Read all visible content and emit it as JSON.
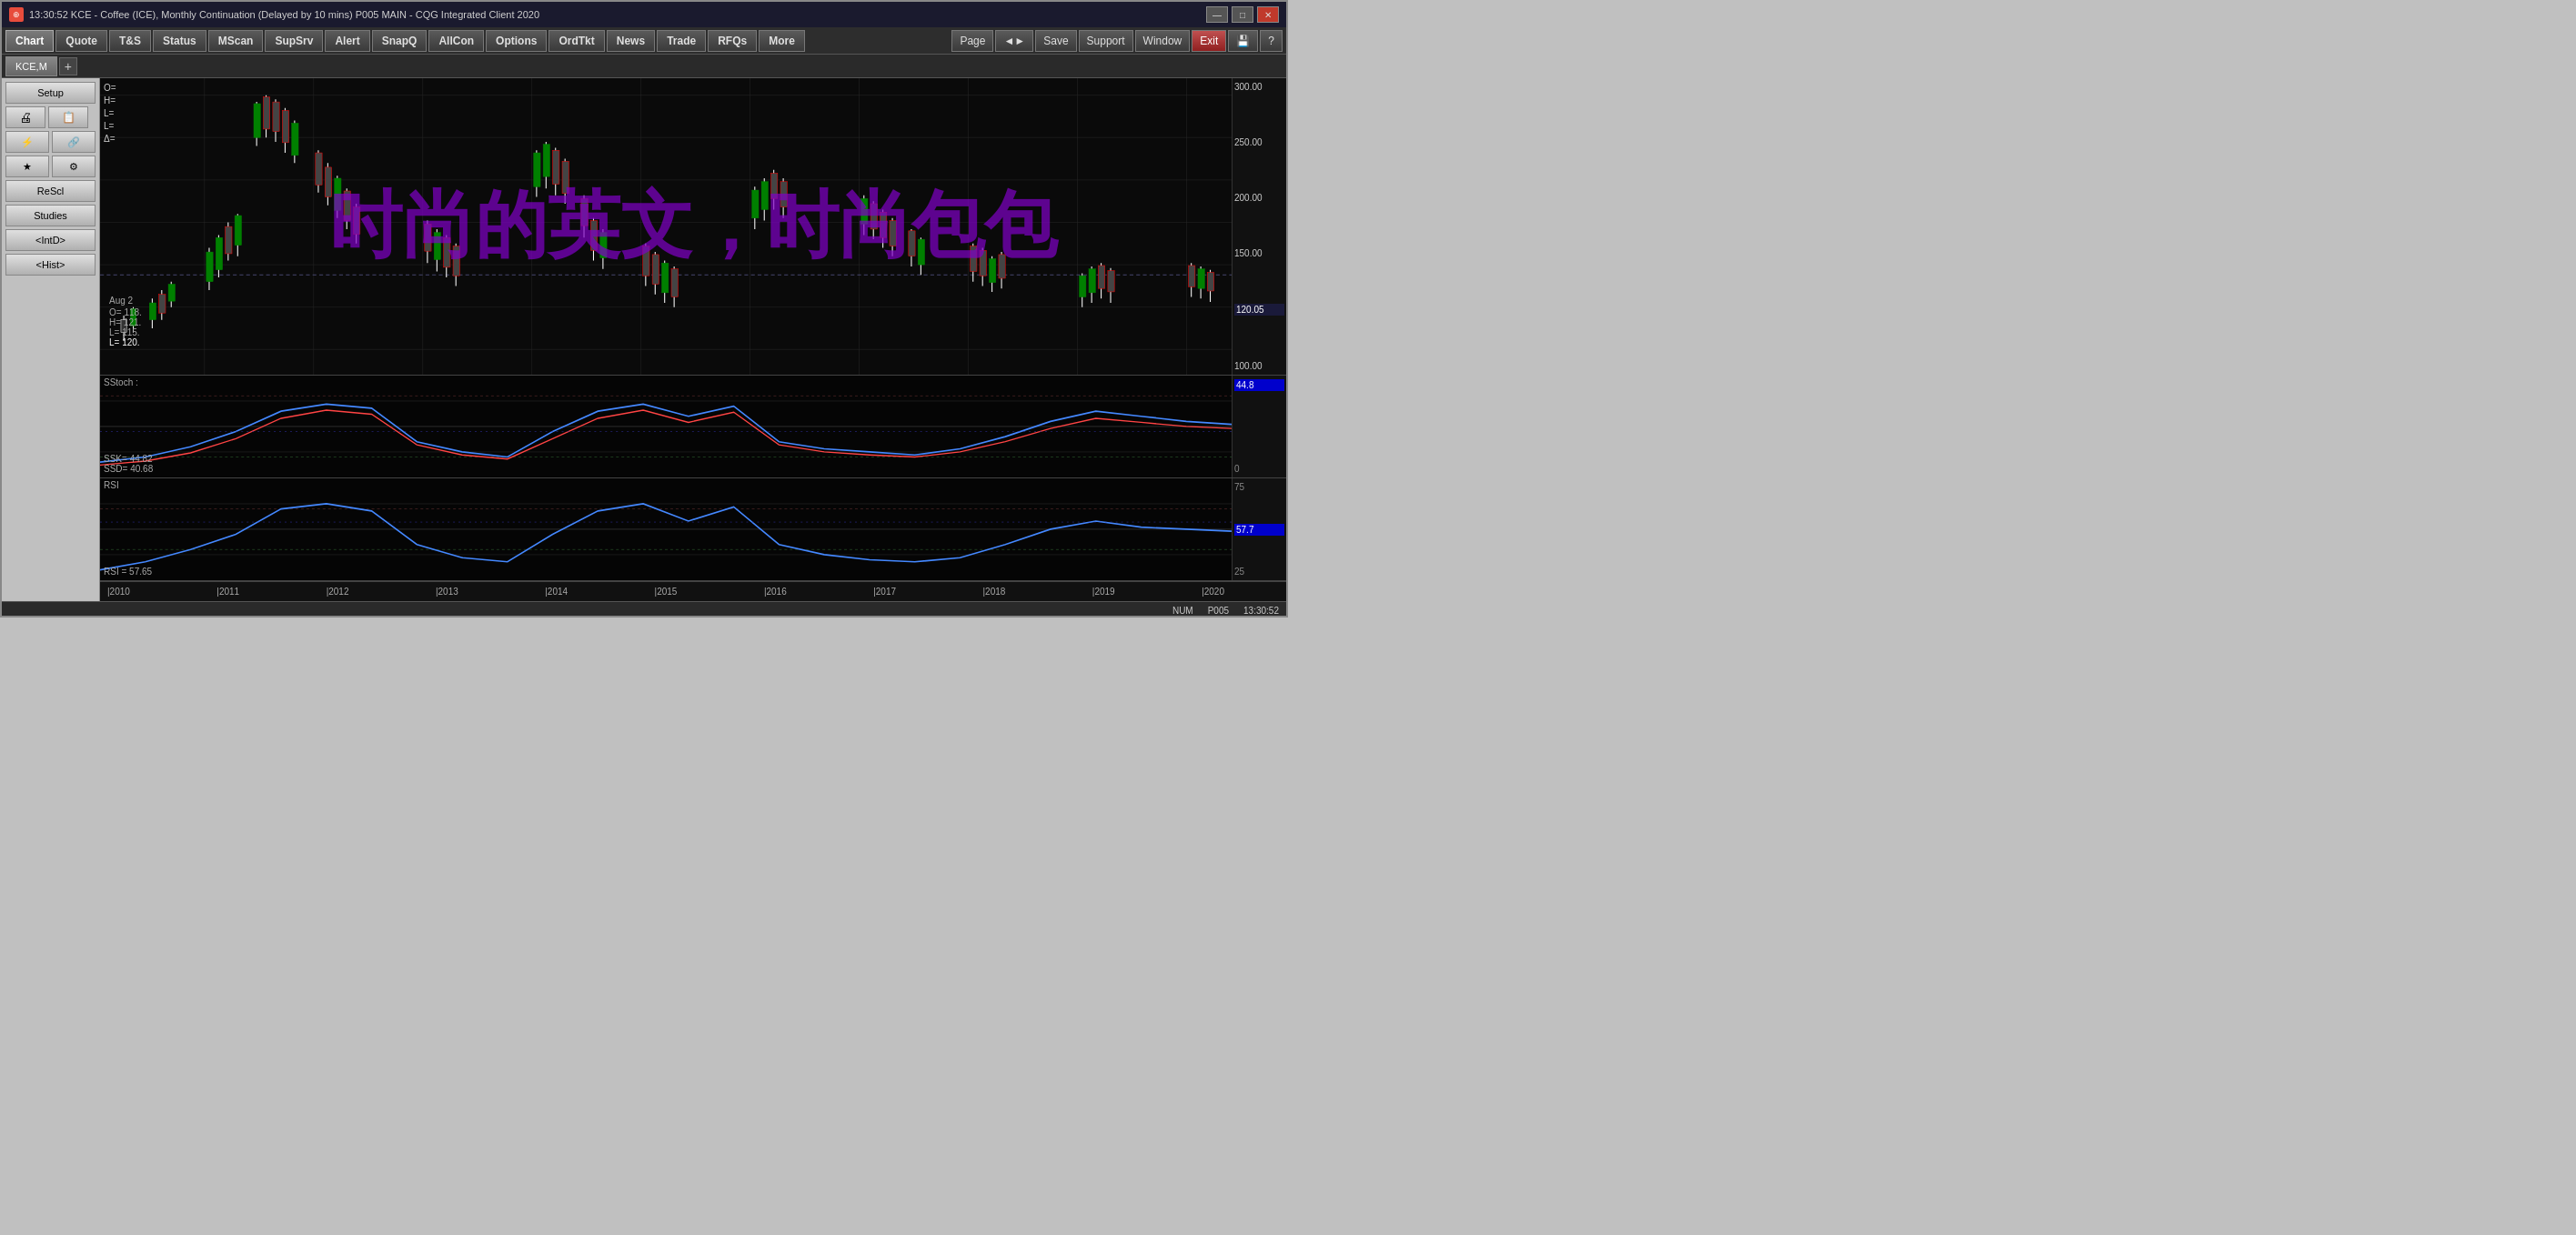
{
  "titleBar": {
    "icon": "★",
    "text": "13:30:52   KCE - Coffee (ICE), Monthly Continuation (Delayed by 10 mins)   P005 MAIN - CQG Integrated Client 2020",
    "buttons": {
      "minimize": "—",
      "maximize": "□",
      "close": "✕"
    }
  },
  "mainToolbar": {
    "buttons": [
      "Chart",
      "Quote",
      "T&S",
      "Status",
      "MScan",
      "SupSrv",
      "Alert",
      "SnapQ",
      "AllCon",
      "Options",
      "OrdTkt",
      "News",
      "Trade",
      "RFQs",
      "More"
    ],
    "activeButton": "Chart",
    "rightButtons": [
      "Page",
      "←→",
      "Save",
      "Support",
      "Window",
      "Exit",
      "🖫",
      "?"
    ]
  },
  "tabBar": {
    "tabs": [
      "KCE,M"
    ],
    "addButton": "+"
  },
  "sidebar": {
    "buttons": [
      {
        "label": "Setup",
        "type": "full"
      },
      {
        "label": "🖨",
        "type": "icon"
      },
      {
        "label": "📋",
        "type": "icon"
      },
      {
        "label": "⚡",
        "type": "half"
      },
      {
        "label": "🔗",
        "type": "half"
      },
      {
        "label": "★",
        "type": "half"
      },
      {
        "label": "⚙",
        "type": "half"
      },
      {
        "label": "ReScl",
        "type": "full"
      },
      {
        "label": "Studies",
        "type": "full"
      },
      {
        "label": "<IntD>",
        "type": "full"
      },
      {
        "label": "<Hist>",
        "type": "full"
      }
    ]
  },
  "chart": {
    "symbol": "KCE,M",
    "currentPrice": "120.05",
    "ohlc": {
      "open": "O=",
      "high": "H=",
      "low": "L=",
      "close": "L=",
      "delta": "Δ="
    },
    "barInfo": {
      "date": "Aug 2",
      "open": "118.",
      "high": "121.",
      "low": "115.",
      "close": "120."
    },
    "priceAxis": {
      "values": [
        "300.00",
        "250.00",
        "200.00",
        "150.00",
        "120.05",
        "100.00"
      ]
    },
    "timeAxis": {
      "labels": [
        "|2010",
        "|2011",
        "|2012",
        "|2013",
        "|2014",
        "|2015",
        "|2016",
        "|2017",
        "|2018",
        "|2019",
        "|2020"
      ]
    }
  },
  "indicators": {
    "sstoch": {
      "label": "SStoch :",
      "ssk": {
        "label": "SSK=",
        "value": "44.82"
      },
      "ssd": {
        "label": "SSD=",
        "value": "40.68"
      },
      "rightBadge": "44.8",
      "zeroBadge": "0",
      "priceAxisValues": [
        "44.8",
        "0"
      ]
    },
    "rsi": {
      "label": "RSI",
      "value": {
        "label": "RSI =",
        "value": "57.65"
      },
      "rightBadge": "57.7",
      "priceAxisValues": [
        "75",
        "57.7",
        "25"
      ]
    }
  },
  "watermark": {
    "text": "时尚的英文，时尚包包"
  },
  "statusBar": {
    "num": "NUM",
    "page": "P005",
    "time": "13:30:52"
  }
}
